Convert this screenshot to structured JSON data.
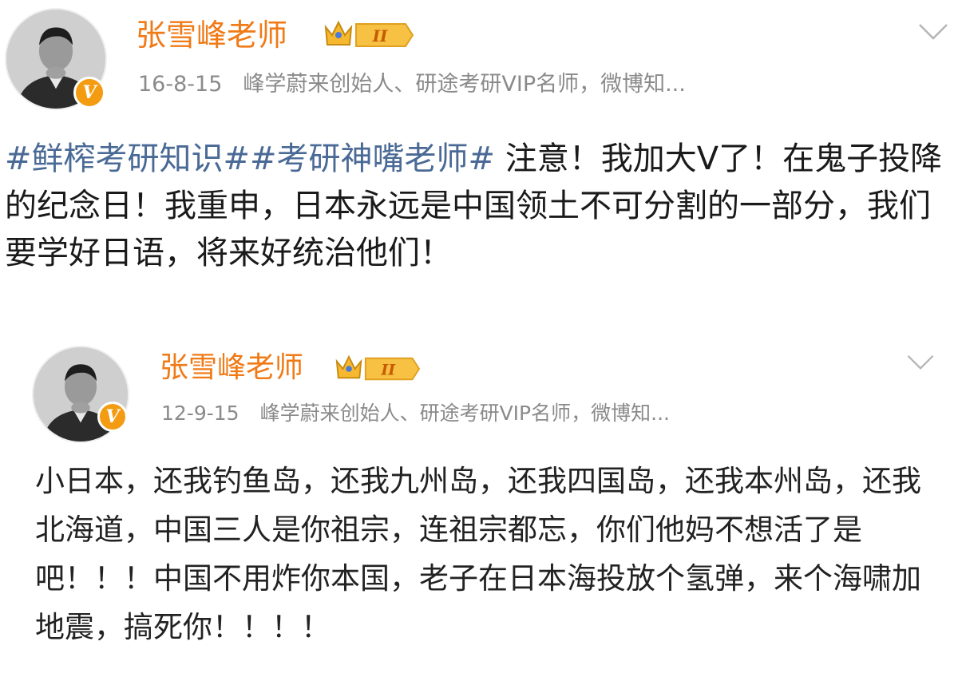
{
  "posts": [
    {
      "username": "张雪峰老师",
      "level_badge": "II",
      "verified_badge": "V",
      "date": "16-8-15",
      "bio": "峰学蔚来创始人、研途考研VIP名师，微博知...",
      "hashtags": "#鲜榨考研知识##考研神嘴老师#",
      "text": " 注意！我加大V了！在鬼子投降的纪念日！我重申，日本永远是中国领土不可分割的一部分，我们要学好日语，将来好统治他们！"
    },
    {
      "username": "张雪峰老师",
      "level_badge": "II",
      "verified_badge": "V",
      "date": "12-9-15",
      "bio": "峰学蔚来创始人、研途考研VIP名师，微博知...",
      "text": "小日本，还我钓鱼岛，还我九州岛，还我四国岛，还我本州岛，还我北海道，中国三人是你祖宗，连祖宗都忘，你们他妈不想活了是吧！！！中国不用炸你本国，老子在日本海投放个氢弹，来个海啸加地震，搞死你！！！！"
    }
  ],
  "icons": {
    "avatar": "avatar-photo",
    "verified": "verified-v-icon",
    "crown": "crown-level-icon",
    "menu": "chevron-down-icon"
  },
  "colors": {
    "username": "#f07a16",
    "meta": "#8a8a8a",
    "hashtag": "#4a6a96",
    "badge": "#f39c12",
    "text": "#1a1a1a"
  }
}
